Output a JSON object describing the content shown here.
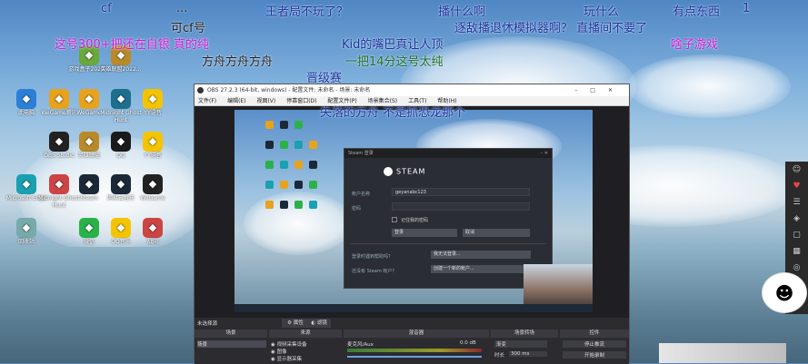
{
  "danmaku": [
    {
      "text": "cf",
      "color": "#1a33a0"
    },
    {
      "text": "...",
      "color": "#222"
    },
    {
      "text": "王者局不玩了？",
      "color": "#1a33a0"
    },
    {
      "text": "播什么啊",
      "color": "#1a33a0"
    },
    {
      "text": "玩什么",
      "color": "#1a33a0"
    },
    {
      "text": "有点东西",
      "color": "#1a33a0"
    },
    {
      "text": "1",
      "color": "#1a33a0"
    },
    {
      "text": "可cf",
      "color": "#222"
    },
    {
      "text": "逐敌播退休模拟器啊？ 直播间不要了",
      "color": "#1a33a0"
    },
    {
      "text": "这号300+把还在自银 真的纯",
      "color": "#d01ad8"
    },
    {
      "text": "Kid的嘴巴真让人顶",
      "color": "#1a33a0"
    },
    {
      "text": "啥子游戏",
      "color": "#d01ad8"
    },
    {
      "text": "方舟方舟方舟",
      "color": "#222"
    },
    {
      "text": "一把14分这号太纯",
      "color": "#1a6e2a"
    },
    {
      "text": "晋级赛",
      "color": "#1a33a0"
    },
    {
      "text": "失落的方舟 不是抓恐龙那个",
      "color": "#1a33a0"
    },
    {
      "text": "号",
      "color": "#222"
    }
  ],
  "desktop_icons": [
    {
      "label": "此电脑",
      "icon": "computer-icon",
      "color": "#2b7fd6"
    },
    {
      "label": "WeGame腾讯",
      "icon": "wegame-icon",
      "color": "#e8a21c"
    },
    {
      "label": "游戏盒子2022...",
      "icon": "game-icon",
      "color": "#6aa83a"
    },
    {
      "label": "英雄联盟2022...",
      "icon": "lol-icon",
      "color": "#b88a2a"
    },
    {
      "label": "WeGame",
      "icon": "wegame-icon",
      "color": "#e8a21c"
    },
    {
      "label": "Midnight Ghost Hunt",
      "icon": "ghost-icon",
      "color": "#1e6e8e"
    },
    {
      "label": "YY语音",
      "icon": "yy-icon",
      "color": "#f5c400"
    },
    {
      "label": "OBS Studio",
      "icon": "obs-icon",
      "color": "#222"
    },
    {
      "label": "英雄联盟",
      "icon": "lol-icon",
      "color": "#b88a2a"
    },
    {
      "label": "QQ",
      "icon": "qq-icon",
      "color": "#1a1a1a"
    },
    {
      "label": "YY语音",
      "icon": "yy-icon",
      "color": "#f5c400"
    },
    {
      "label": "Microsoft Edge",
      "icon": "edge-icon",
      "color": "#1aa0b0"
    },
    {
      "label": "Midnight Ghost Hunt",
      "icon": "ghost-icon",
      "color": "#c44"
    },
    {
      "label": "Steam",
      "icon": "steam-icon",
      "color": "#1b2838"
    },
    {
      "label": "网易云音乐",
      "icon": "music-icon",
      "color": "#1b2838"
    },
    {
      "label": "WeGame",
      "icon": "wegame-icon",
      "color": "#222"
    },
    {
      "label": "回收站",
      "icon": "recycle-bin-icon",
      "color": "#7aa"
    },
    {
      "label": "微信",
      "icon": "wechat-icon",
      "color": "#2ab24a"
    },
    {
      "label": "QQ音乐",
      "icon": "music-icon",
      "color": "#f5c400"
    },
    {
      "label": "战网",
      "icon": "battlenet-icon",
      "color": "#c44"
    }
  ],
  "obs": {
    "title": "OBS 27.2.3 (64-bit, windows) - 配置文件: 未命名 - 场景: 未命名",
    "menu": [
      "文件(F)",
      "编辑(E)",
      "视图(V)",
      "停靠窗口(D)",
      "配置文件(P)",
      "场景集合(S)",
      "工具(T)",
      "帮助(H)"
    ],
    "no_source": "未选择源",
    "props_btn": "属性",
    "filters_btn": "滤镜",
    "panels": {
      "scenes": "场景",
      "sources": "来源",
      "mixer": "混音器",
      "transitions": "场景转场",
      "controls": "控件"
    },
    "scene_items": [
      "场景"
    ],
    "source_items": [
      "视频采集设备",
      "图像",
      "显示器采集"
    ],
    "mixer_items": [
      {
        "name": "麦克风/Aux",
        "db": "0.0 dB"
      }
    ],
    "transition": "渐变",
    "duration_label": "时长",
    "duration": "300 ms",
    "controls": [
      "停止推流",
      "开始录制"
    ]
  },
  "steam": {
    "window_title": "Steam 登录",
    "logo": "STEAM",
    "account_label": "帐户名称",
    "account_value": "geyanabc123",
    "password_label": "密码",
    "remember": "记住我的密码",
    "login_btn": "登录",
    "cancel_btn": "取消",
    "forgot_text": "登录时遇到帮助吗？",
    "forgot_btn": "我无法登录...",
    "no_account_text": "还没有 Steam 帐户？",
    "create_btn": "创建一个新的帐户..."
  }
}
